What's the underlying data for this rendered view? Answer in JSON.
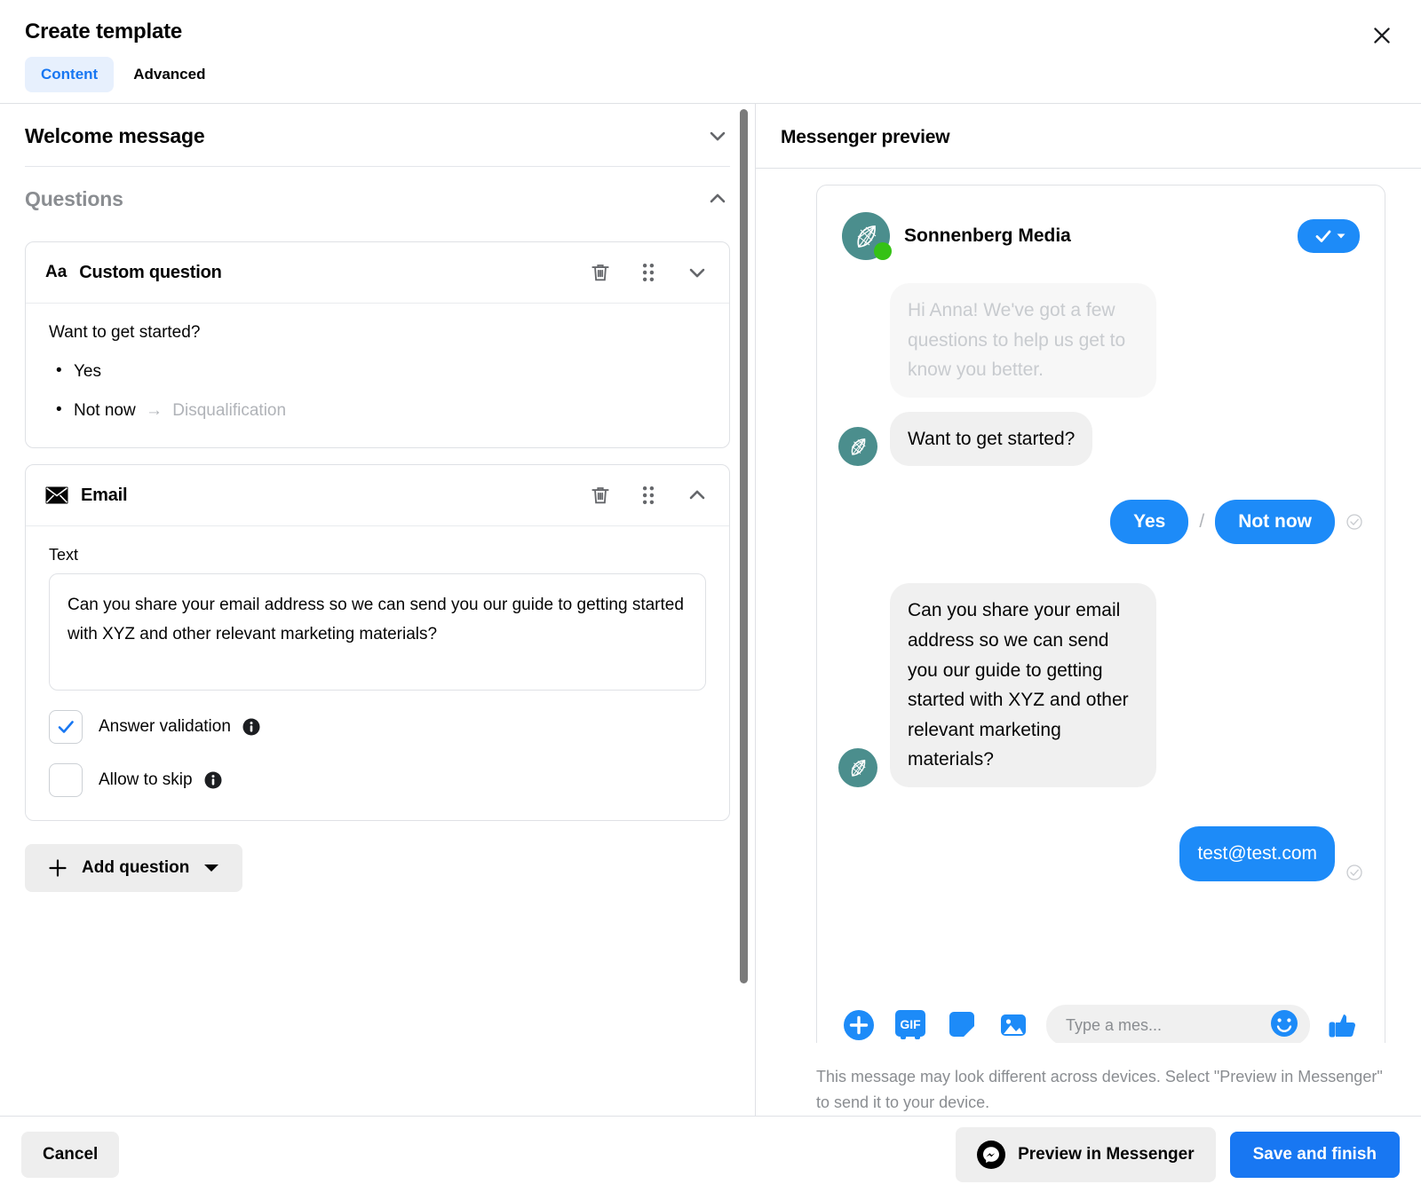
{
  "header": {
    "title": "Create template",
    "close_icon": "close-icon",
    "tabs": [
      {
        "label": "Content",
        "active": true
      },
      {
        "label": "Advanced",
        "active": false
      }
    ]
  },
  "left_pane": {
    "sections": [
      {
        "title": "Welcome message",
        "chevron": "chevron-down-icon",
        "expanded": false
      },
      {
        "title": "Questions",
        "chevron": "chevron-up-icon",
        "expanded": true
      }
    ],
    "cards": [
      {
        "type_icon": "Aa",
        "title": "Custom question",
        "delete_icon": "trash-icon",
        "drag_icon": "drag-handle-icon",
        "collapse_icon": "chevron-down-icon",
        "prompt": "Want to get started?",
        "options": [
          {
            "label": "Yes",
            "target": ""
          },
          {
            "label": "Not now",
            "target": "Disqualification"
          }
        ]
      },
      {
        "type_icon": "envelope-icon",
        "title": "Email",
        "delete_icon": "trash-icon",
        "drag_icon": "drag-handle-icon",
        "collapse_icon": "chevron-up-icon",
        "text_label": "Text",
        "text_value": "Can you share your email address so we can send you our guide to getting started with XYZ and other relevant marketing materials?",
        "checkboxes": [
          {
            "label": "Answer validation",
            "checked": true,
            "info": "info-icon"
          },
          {
            "label": "Allow to skip",
            "checked": false,
            "info": "info-icon"
          }
        ]
      }
    ],
    "add_question": {
      "label": "Add question",
      "plus_icon": "plus-icon",
      "caret_icon": "caret-down-icon"
    }
  },
  "right_pane": {
    "title": "Messenger preview",
    "chat": {
      "profile_name": "Sonnenberg Media",
      "avatar_icon": "leaf-logo-icon",
      "online": true,
      "verified_badge": "check-badge-icon",
      "messages": [
        {
          "side": "in",
          "faded": true,
          "avatar": false,
          "text": "Hi Anna! We've got a few questions to help us get to know you better."
        },
        {
          "side": "in",
          "faded": false,
          "avatar": true,
          "text": "Want to get started?"
        },
        {
          "side": "in",
          "faded": false,
          "avatar": true,
          "text": "Can you share your email address so we can send you our guide to getting started with XYZ and other relevant marketing materials?"
        },
        {
          "side": "out",
          "faded": false,
          "avatar": false,
          "text": "test@test.com"
        }
      ],
      "quick_replies": [
        {
          "label": "Yes"
        },
        {
          "label": "Not now"
        }
      ],
      "quick_reply_separator": "/",
      "composer": {
        "icons": [
          "plus-circle-icon",
          "gif-icon",
          "sticker-icon",
          "image-icon"
        ],
        "gif_label": "GIF",
        "placeholder": "Type a mes...",
        "emoji_icon": "emoji-smile-icon",
        "thumbs_up_icon": "thumbs-up-icon"
      }
    },
    "note": "This message may look different across devices. Select \"Preview in Messenger\" to send it to your device."
  },
  "footer": {
    "cancel_label": "Cancel",
    "preview_label": "Preview in Messenger",
    "preview_icon": "messenger-logo-icon",
    "save_label": "Save and finish"
  },
  "colors": {
    "accent_blue": "#1877f2",
    "messenger_blue": "#1d8bf8",
    "tab_active_bg": "#e7f0fd",
    "avatar_teal": "#4b8e8d",
    "online_green": "#35c215",
    "bubble_gray": "#f0f0f0",
    "muted_text": "#8a8d91"
  }
}
